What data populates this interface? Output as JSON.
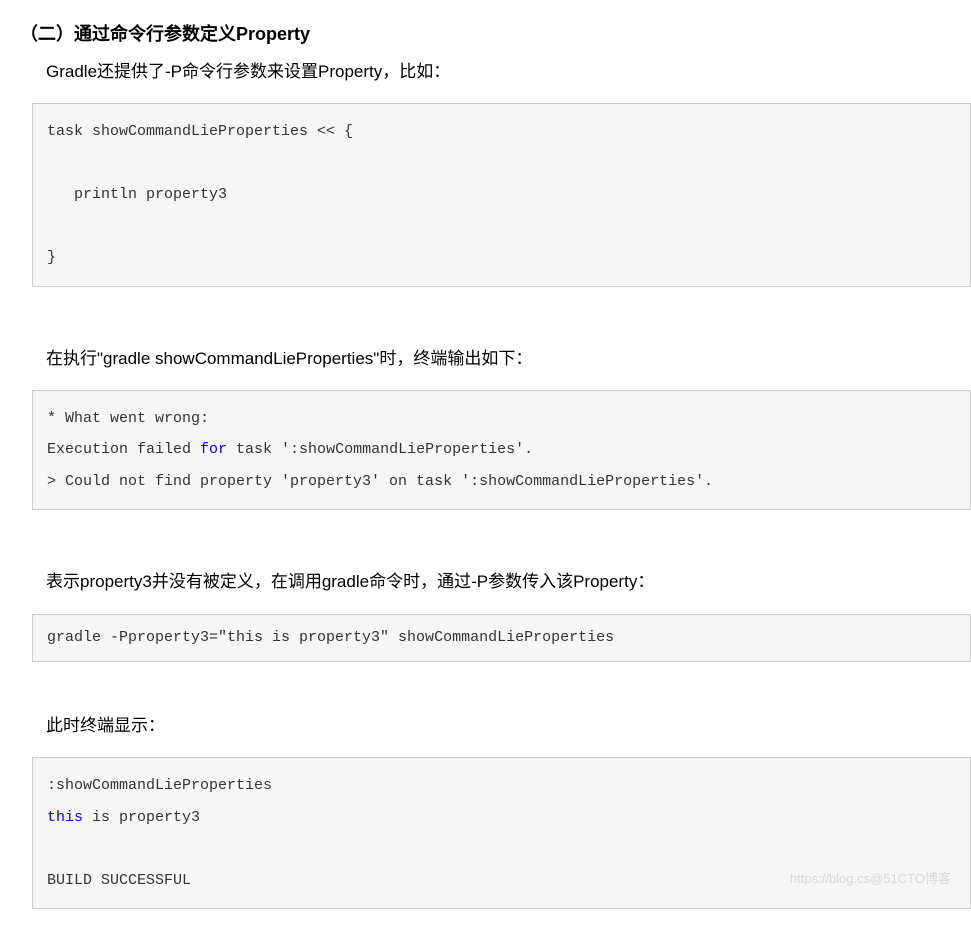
{
  "title": "（二）通过命令行参数定义Property",
  "intro": "Gradle还提供了-P命令行参数来设置Property，比如：",
  "code1": {
    "raw": "task showCommandLieProperties << {\n\n   println property3\n\n}"
  },
  "para2": "在执行\"gradle showCommandLieProperties\"时，终端输出如下：",
  "code2": {
    "line1": "* What went wrong:",
    "line2_a": "Execution failed ",
    "line2_kw": "for",
    "line2_b": " task ':showCommandLieProperties'.",
    "line3": "> Could not find property 'property3' on task ':showCommandLieProperties'."
  },
  "para3": "表示property3并没有被定义，在调用gradle命令时，通过-P参数传入该Property：",
  "code3": {
    "raw": "gradle -Pproperty3=\"this is property3\" showCommandLieProperties"
  },
  "para4": "此时终端显示：",
  "code4": {
    "line1": ":showCommandLieProperties",
    "line2_kw": "this",
    "line2_b": " is property3",
    "blank": "",
    "line3": "BUILD SUCCESSFUL"
  },
  "watermark": "https://blog.cs@51CTO博客"
}
